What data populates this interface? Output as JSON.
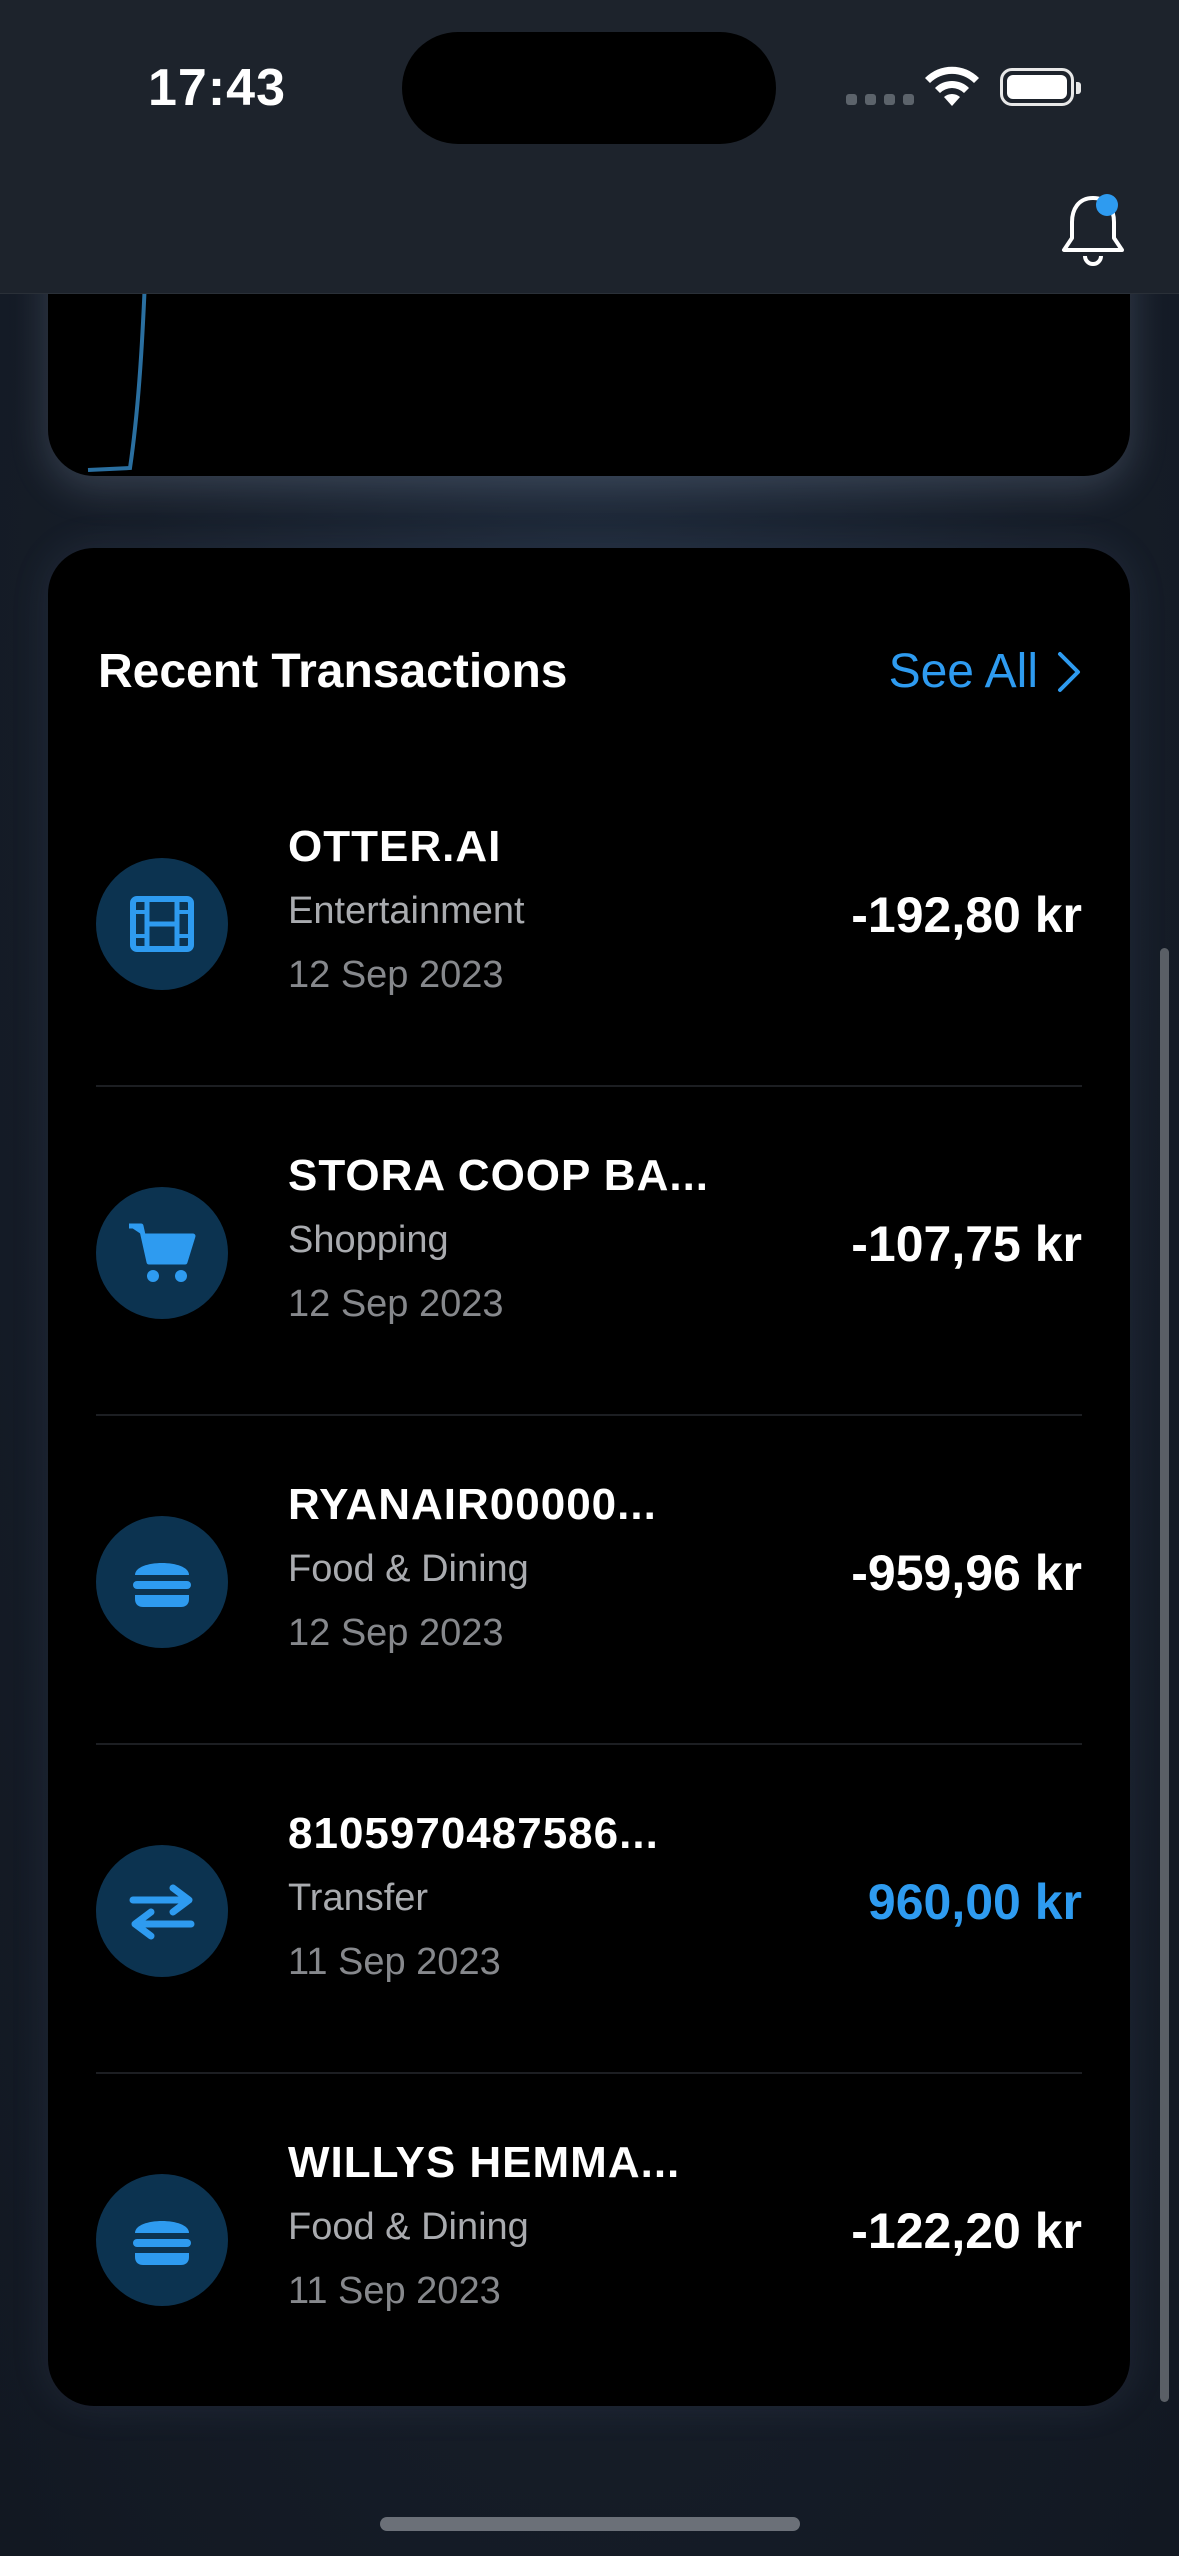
{
  "status_bar": {
    "time": "17:43"
  },
  "colors": {
    "accent": "#2e9bf0",
    "icon_bg": "#0c3350",
    "card_bg": "#000000"
  },
  "transactions_section": {
    "title": "Recent Transactions",
    "see_all_label": "See All",
    "items": [
      {
        "merchant": "OTTER.AI",
        "category": "Entertainment",
        "date": "12 Sep 2023",
        "amount": "-192,80 kr",
        "icon": "film-icon",
        "positive": false
      },
      {
        "merchant": "STORA COOP BA...",
        "category": "Shopping",
        "date": "12 Sep 2023",
        "amount": "-107,75 kr",
        "icon": "cart-icon",
        "positive": false
      },
      {
        "merchant": "RYANAIR00000...",
        "category": "Food & Dining",
        "date": "12 Sep 2023",
        "amount": "-959,96 kr",
        "icon": "burger-icon",
        "positive": false
      },
      {
        "merchant": "8105970487586...",
        "category": "Transfer",
        "date": "11 Sep 2023",
        "amount": "960,00 kr",
        "icon": "transfer-icon",
        "positive": true
      },
      {
        "merchant": "WILLYS HEMMA...",
        "category": "Food & Dining",
        "date": "11 Sep 2023",
        "amount": "-122,20 kr",
        "icon": "burger-icon",
        "positive": false
      }
    ]
  }
}
